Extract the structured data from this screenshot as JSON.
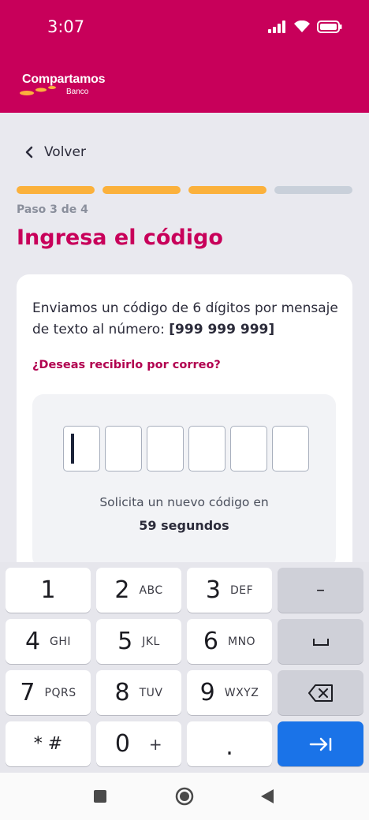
{
  "status_bar": {
    "time": "3:07"
  },
  "header": {
    "brand_name": "Compartamos",
    "brand_sub": "Banco",
    "brand_color": "#c8005a"
  },
  "nav": {
    "back_label": "Volver"
  },
  "progress": {
    "total": 4,
    "completed": 3,
    "step_label": "Paso 3 de 4"
  },
  "page": {
    "title": "Ingresa el código"
  },
  "card": {
    "message_prefix": "Enviamos un código de 6 dígitos por mensaje de texto al número: ",
    "phone": "[999 999 999]",
    "email_link": "¿Deseas recibirlo por correo?",
    "resend_label": "Solicita un nuevo código en",
    "resend_time": "59 segundos"
  },
  "code_inputs": {
    "count": 6,
    "active_index": 0
  },
  "keyboard": {
    "keys": [
      {
        "num": "1",
        "letters": ""
      },
      {
        "num": "2",
        "letters": "ABC"
      },
      {
        "num": "3",
        "letters": "DEF"
      },
      {
        "num": "4",
        "letters": "GHI"
      },
      {
        "num": "5",
        "letters": "JKL"
      },
      {
        "num": "6",
        "letters": "MNO"
      },
      {
        "num": "7",
        "letters": "PQRS"
      },
      {
        "num": "8",
        "letters": "TUV"
      },
      {
        "num": "9",
        "letters": "WXYZ"
      },
      {
        "num": "* #",
        "letters": ""
      },
      {
        "num": "0",
        "letters": "+"
      },
      {
        "num": ".",
        "letters": ""
      }
    ],
    "dash_key": "–",
    "accent_color": "#1a73e8"
  }
}
